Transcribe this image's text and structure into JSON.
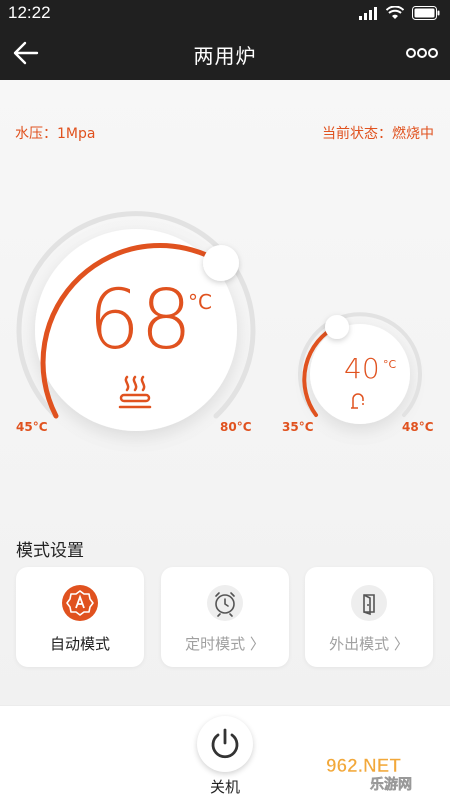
{
  "status_bar": {
    "time": "12:22"
  },
  "header": {
    "title": "两用炉"
  },
  "info": {
    "water_pressure": "水压：1Mpa",
    "current_status": "当前状态：燃烧中"
  },
  "heating_dial": {
    "temperature": "68",
    "unit": "°C",
    "min_label": "45°C",
    "max_label": "80°C",
    "icon": "heating-icon",
    "accent_color": "#e0521f"
  },
  "water_dial": {
    "temperature": "40",
    "unit": "°C",
    "min_label": "35°C",
    "max_label": "48°C",
    "icon": "tap-icon"
  },
  "mode_settings": {
    "title": "模式设置",
    "modes": [
      {
        "label": "自动模式",
        "icon": "auto-mode-icon",
        "active": true
      },
      {
        "label": "定时模式 〉",
        "icon": "alarm-clock-icon",
        "active": false
      },
      {
        "label": "外出模式 〉",
        "icon": "door-exit-icon",
        "active": false
      }
    ]
  },
  "bottom": {
    "power_label": "关机",
    "icon": "power-icon"
  },
  "watermark": {
    "text": "962.NET",
    "subtext": "乐游网"
  }
}
